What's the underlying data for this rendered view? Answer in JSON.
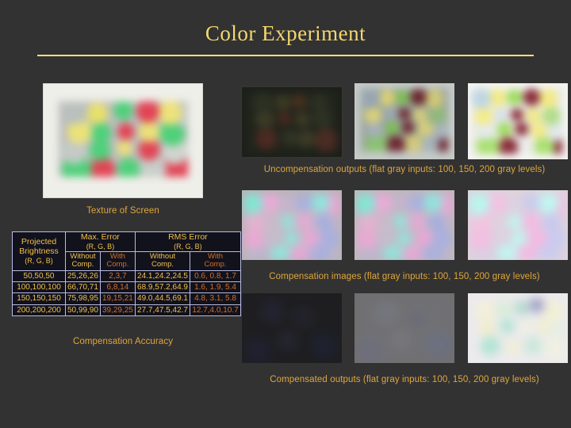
{
  "slide": {
    "title": "Color Experiment"
  },
  "captions": {
    "texture_of_screen": "Texture of Screen",
    "compensation_accuracy": "Compensation Accuracy",
    "uncompensation_outputs": "Uncompensation outputs (flat gray inputs: 100, 150, 200 gray levels)",
    "compensation_images": "Compensation images (flat gray inputs: 100, 150, 200 gray levels)",
    "compensated_outputs": "Compensated outputs (flat gray inputs: 100, 150, 200 gray levels)"
  },
  "colors": {
    "background": "#323232",
    "title": "#f5d76e",
    "rule": "#f7e07a",
    "caption": "#e0a63c",
    "table_border": "#b9bbe4",
    "table_bg": "#12121c",
    "yellow_text": "#f0c14b",
    "orange_text": "#d2702a"
  },
  "table": {
    "col0_header": "Projected Brightness",
    "col0_header_line1": "Projected",
    "col0_header_line2": "Brightness",
    "col0_header_sub": "(R, G, B)",
    "group1_header": "Max. Error",
    "group1_sub": "(R, G, B)",
    "group2_header": "RMS Error",
    "group2_sub": "(R, G, B)",
    "sub_headers": [
      {
        "line1": "Without",
        "line2": "Comp."
      },
      {
        "line1": "With",
        "line2": "Comp."
      },
      {
        "line1": "Without",
        "line2": "Comp."
      },
      {
        "line1": "With",
        "line2": "Comp."
      }
    ],
    "rows": [
      {
        "brightness": "50,50,50",
        "max_without": "25,26,26",
        "max_with": "2,3,7",
        "rms_without": "24.1,24.2,24.5",
        "rms_with": "0.6, 0.8, 1.7"
      },
      {
        "brightness": "100,100,100",
        "max_without": "66,70,71",
        "max_with": "6,8,14",
        "rms_without": "68.9,57.2,64.9",
        "rms_with": "1.6, 1.9, 5.4"
      },
      {
        "brightness": "150,150,150",
        "max_without": "75,98,95",
        "max_with": "19,15,21",
        "rms_without": "49.0,44.5,69.1",
        "rms_with": "4.8, 3.1, 5.8"
      },
      {
        "brightness": "200,200,200",
        "max_without": "50,99,90",
        "max_with": "39,29,25",
        "rms_without": "27.7,47.5,42.7",
        "rms_with": "12.7,4.0,10.7"
      }
    ]
  },
  "panels": {
    "screen_texture": "screen-texture-photo",
    "uncompensated": [
      {
        "name": "uncompensated-output-100",
        "gray_level": "100"
      },
      {
        "name": "uncompensated-output-150",
        "gray_level": "150"
      },
      {
        "name": "uncompensated-output-200",
        "gray_level": "200"
      }
    ],
    "compensation": [
      {
        "name": "compensation-image-100",
        "gray_level": "100"
      },
      {
        "name": "compensation-image-150",
        "gray_level": "150"
      },
      {
        "name": "compensation-image-200",
        "gray_level": "200"
      }
    ],
    "compensated": [
      {
        "name": "compensated-output-100",
        "gray_level": "100"
      },
      {
        "name": "compensated-output-150",
        "gray_level": "150"
      },
      {
        "name": "compensated-output-200",
        "gray_level": "200"
      }
    ]
  }
}
